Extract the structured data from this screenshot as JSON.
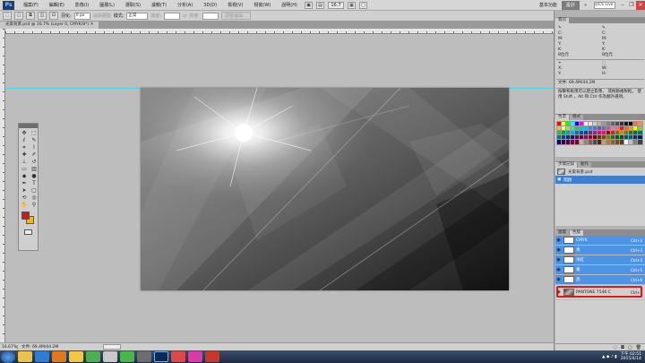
{
  "menubar": {
    "app_logo": "Ps",
    "menus": [
      "檔案(F)",
      "編輯(E)",
      "影像(I)",
      "圖層(L)",
      "選取(S)",
      "濾鏡(T)",
      "分析(A)",
      "3D(D)",
      "檢視(V)",
      "視窗(W)",
      "說明(H)"
    ],
    "zoom_value": "16.7",
    "workspaces": [
      "基本功能",
      "設計"
    ],
    "active_workspace": "設計",
    "search_label": "CS Live"
  },
  "options": {
    "feather_label": "羽化:",
    "feather_value": "0 px",
    "antialias_label": "消除鋸齒",
    "style_label": "樣式:",
    "style_value": "正常",
    "width_label": "寬度:",
    "height_label": "高度:",
    "refine_label": "調整邊緣..."
  },
  "document": {
    "tab_title": "光束背景.psd @ 16.7% (Layer 0, CMYK/8*) ✕"
  },
  "statusbar": {
    "zoom": "16.67%",
    "doc_info": "文件: 69.4M/44.2M"
  },
  "info_panel": {
    "tabs": [
      "資訊"
    ],
    "labels": [
      "C:",
      "M:",
      "Y:",
      "K:",
      "8位元"
    ],
    "xy": [
      "X:",
      "Y:"
    ],
    "wh": [
      "W:",
      "H:"
    ],
    "doc_size": "文件: 69.4M/44.2M",
    "hint": "按擊和拖曳可以建立影像， 或拖動複製框， 使用 Shift ，Alt 和 Ctrl 作為額外選項。"
  },
  "swatch_panel": {
    "tabs": [
      "色票",
      "樣式"
    ],
    "colors": [
      "#ff0000",
      "#ffff00",
      "#00ff00",
      "#00ffff",
      "#0000ff",
      "#ff00ff",
      "#ffffff",
      "#e6e6e6",
      "#cccccc",
      "#b3b3b3",
      "#999999",
      "#808080",
      "#666666",
      "#4d4d4d",
      "#333333",
      "#1a1a1a",
      "#000000",
      "#f26c4f",
      "#f68e56",
      "#fbaf5d",
      "#fff568",
      "#acd373",
      "#7cc576",
      "#3bb878",
      "#1abbb4",
      "#00bff3",
      "#438ccb",
      "#5574b9",
      "#605ca8",
      "#855fa8",
      "#a763a8",
      "#f06eaa",
      "#f26d7d",
      "#ed1c24",
      "#f26522",
      "#f7941d",
      "#fff200",
      "#8dc63f",
      "#39b54a",
      "#00a651",
      "#00a99d",
      "#00aeef",
      "#0072bc",
      "#0054a6",
      "#2e3192",
      "#662d91",
      "#92278f",
      "#ec008c",
      "#ed145b",
      "#9e0b0f",
      "#a0410d",
      "#a36209",
      "#aba000",
      "#598527",
      "#1a7b30",
      "#007236",
      "#00746b",
      "#0076a3",
      "#004b80",
      "#003471",
      "#1b1464",
      "#440e62",
      "#630460",
      "#9e005d",
      "#9e0039",
      "#790000",
      "#7b2e00",
      "#7d4900",
      "#827b00",
      "#406618",
      "#005e20",
      "#005826",
      "#005952",
      "#005b7f",
      "#003663",
      "#002157",
      "#0d004c",
      "#32004b",
      "#4b0049",
      "#7b0046",
      "#7a0026",
      "#c7b299",
      "#998675",
      "#736357",
      "#534741",
      "#37302a",
      "#c69c6d",
      "#a67c52",
      "#8c6239",
      "#754c24",
      "#603913",
      "#ffffff",
      "#c0c0c0",
      "#808080",
      "#404040"
    ]
  },
  "history_panel": {
    "tabs": [
      "步驟記錄",
      "動作"
    ],
    "snapshot": "光束背景.psd",
    "items": [
      "開啟"
    ]
  },
  "layers_panel": {
    "tabs": [
      "圖層",
      "色版"
    ],
    "rows": [
      {
        "name": "CMYK",
        "shortcut": "Ctrl+2",
        "type": "channel"
      },
      {
        "name": "青",
        "shortcut": "Ctrl+3",
        "type": "channel"
      },
      {
        "name": "洋紅",
        "shortcut": "Ctrl+4",
        "type": "channel"
      },
      {
        "name": "黃",
        "shortcut": "Ctrl+5",
        "type": "channel"
      },
      {
        "name": "黑",
        "shortcut": "Ctrl+6",
        "type": "channel"
      },
      {
        "name": "PANTONE 7546 C",
        "shortcut": "Ctrl+7",
        "type": "pantone"
      }
    ]
  },
  "taskbar": {
    "time": "下午 02:51",
    "date": "2015/4/14"
  }
}
